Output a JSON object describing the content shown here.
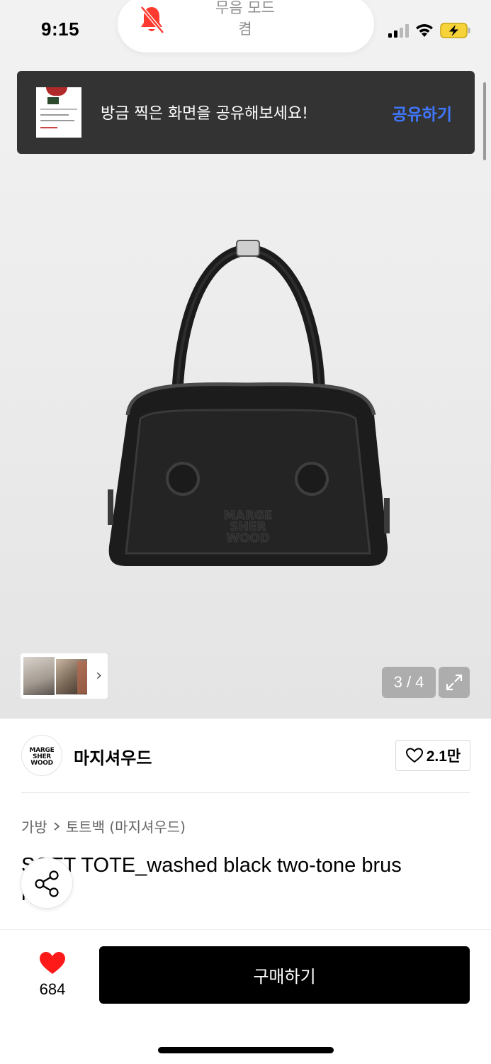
{
  "status_bar": {
    "time": "9:15",
    "island_line1": "무음 모드",
    "island_line2": "켬",
    "icons": [
      "bell-slash-icon",
      "cellular-signal-icon",
      "wifi-icon",
      "battery-charging-icon"
    ]
  },
  "toast": {
    "message": "방금 찍은 화면을 공유해보세요!",
    "action_label": "공유하기"
  },
  "gallery": {
    "counter": "3 / 4",
    "icons": [
      "chevron-right-icon",
      "expand-icon"
    ]
  },
  "brand": {
    "logo_line1": "MARGE",
    "logo_line2": "SHER",
    "logo_line3": "WOOD",
    "name": "마지셔우드",
    "like_count": "2.1만"
  },
  "breadcrumb": {
    "category": "가방",
    "subcategory": "토트백 (마지셔우드)"
  },
  "product": {
    "title": "SOFT TOTE_washed black two-tone brus",
    "title_line2": "h"
  },
  "bottom_bar": {
    "wish_count": "684",
    "buy_label": "구매하기"
  },
  "colors": {
    "toast_bg": "#333333",
    "toast_action": "#3f78ff",
    "heart": "#ff1a1a",
    "buy_button": "#000000"
  }
}
